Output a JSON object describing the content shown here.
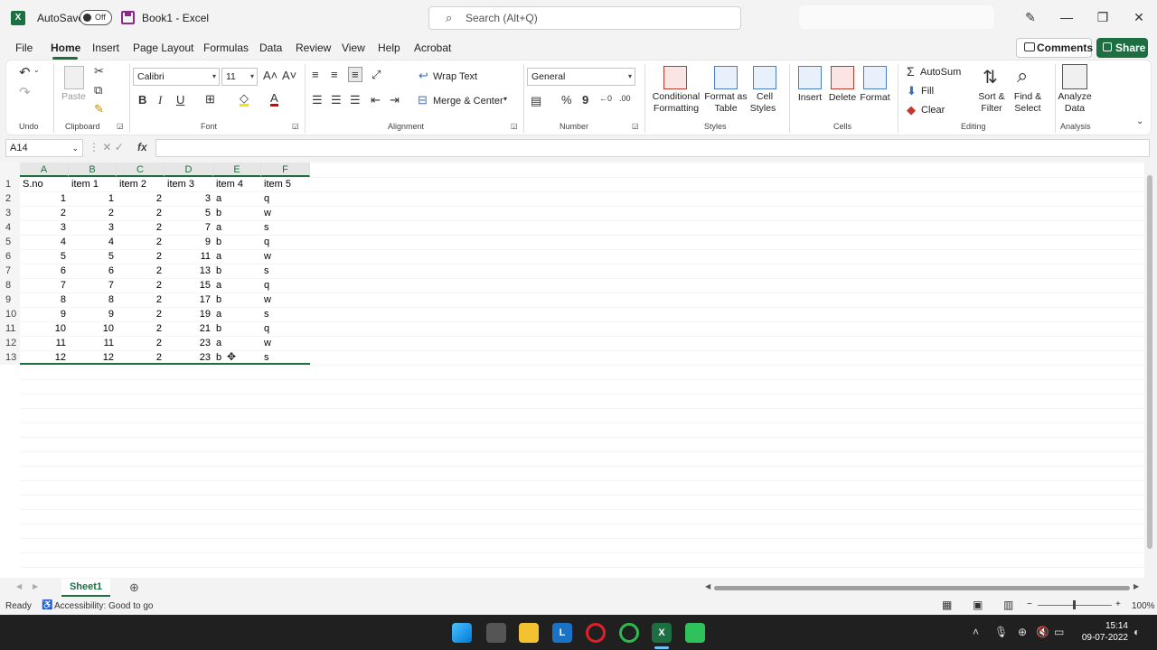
{
  "titlebar": {
    "autosave_label": "AutoSave",
    "autosave_state": "Off",
    "document_title": "Book1  -  Excel",
    "search_placeholder": "Search (Alt+Q)"
  },
  "menu": {
    "tabs": [
      "File",
      "Home",
      "Insert",
      "Page Layout",
      "Formulas",
      "Data",
      "Review",
      "View",
      "Help",
      "Acrobat"
    ],
    "active_tab": "Home",
    "comments_label": "Comments",
    "share_label": "Share"
  },
  "ribbon": {
    "groups": {
      "undo": "Undo",
      "clipboard": "Clipboard",
      "font": "Font",
      "alignment": "Alignment",
      "number": "Number",
      "styles": "Styles",
      "cells": "Cells",
      "editing": "Editing",
      "analysis": "Analysis"
    },
    "paste_label": "Paste",
    "font_name": "Calibri",
    "font_size": "11",
    "bold": "B",
    "italic": "I",
    "underline": "U",
    "wrap_text": "Wrap Text",
    "merge_center": "Merge & Center",
    "number_format": "General",
    "conditional_formatting_1": "Conditional",
    "conditional_formatting_2": "Formatting",
    "format_as_table_1": "Format as",
    "format_as_table_2": "Table",
    "cell_styles_1": "Cell",
    "cell_styles_2": "Styles",
    "insert": "Insert",
    "delete": "Delete",
    "format": "Format",
    "autosum": "AutoSum",
    "fill": "Fill",
    "clear": "Clear",
    "sort_filter_1": "Sort &",
    "sort_filter_2": "Filter",
    "find_select_1": "Find &",
    "find_select_2": "Select",
    "analyze_data_1": "Analyze",
    "analyze_data_2": "Data"
  },
  "formula_bar": {
    "name_box": "A14",
    "fx": "fx",
    "formula": ""
  },
  "sheet": {
    "columns": [
      "A",
      "B",
      "C",
      "D",
      "E",
      "F"
    ],
    "rows": [
      [
        "S.no",
        "item 1",
        "item 2",
        "item 3",
        "item 4",
        "item 5"
      ],
      [
        "1",
        "1",
        "2",
        "3",
        "a",
        "q"
      ],
      [
        "2",
        "2",
        "2",
        "5",
        "b",
        "w"
      ],
      [
        "3",
        "3",
        "2",
        "7",
        "a",
        "s"
      ],
      [
        "4",
        "4",
        "2",
        "9",
        "b",
        "q"
      ],
      [
        "5",
        "5",
        "2",
        "11",
        "a",
        "w"
      ],
      [
        "6",
        "6",
        "2",
        "13",
        "b",
        "s"
      ],
      [
        "7",
        "7",
        "2",
        "15",
        "a",
        "q"
      ],
      [
        "8",
        "8",
        "2",
        "17",
        "b",
        "w"
      ],
      [
        "9",
        "9",
        "2",
        "19",
        "a",
        "s"
      ],
      [
        "10",
        "10",
        "2",
        "21",
        "b",
        "q"
      ],
      [
        "11",
        "11",
        "2",
        "23",
        "a",
        "w"
      ],
      [
        "12",
        "12",
        "2",
        "23",
        "b",
        "s"
      ]
    ],
    "row_numbers": [
      "1",
      "2",
      "3",
      "4",
      "5",
      "6",
      "7",
      "8",
      "9",
      "10",
      "11",
      "12",
      "13"
    ],
    "tab_name": "Sheet1"
  },
  "statusbar": {
    "ready": "Ready",
    "accessibility": "Accessibility: Good to go",
    "zoom": "100%"
  },
  "taskbar": {
    "time": "15:14",
    "date": "09-07-2022"
  },
  "colors": {
    "excel_green": "#1d6f42",
    "taskbar": "#202020"
  }
}
